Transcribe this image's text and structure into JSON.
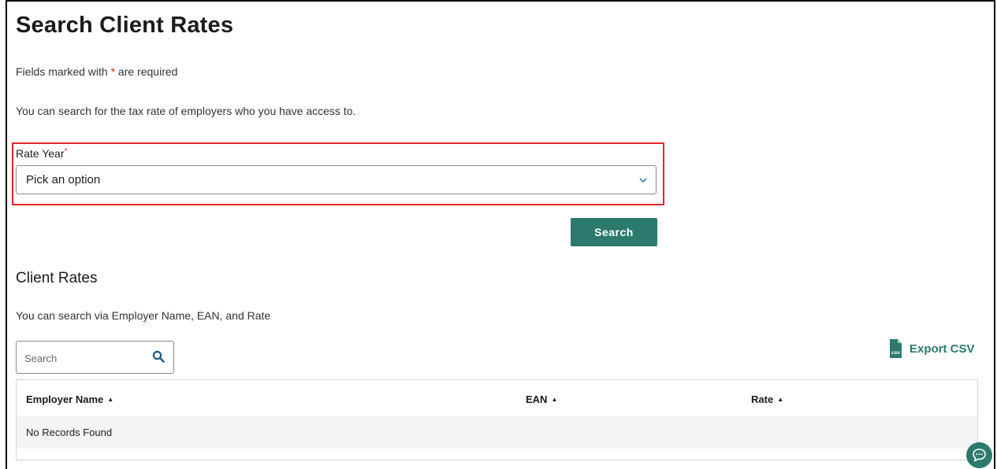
{
  "page": {
    "title": "Search Client Rates",
    "required_note_prefix": "Fields marked with ",
    "required_star": "*",
    "required_note_suffix": " are required",
    "intro": "You can search for the tax rate of employers who you have access to."
  },
  "rate_year": {
    "label": "Rate Year",
    "required_star": "*",
    "selected": "Pick an option"
  },
  "search_button": {
    "label": "Search"
  },
  "client_rates": {
    "title": "Client Rates",
    "intro": "You can search via Employer Name, EAN, and Rate",
    "search_placeholder": "Search",
    "export_label": "Export CSV",
    "export_icon_text": "csv",
    "columns": [
      {
        "label": "Employer Name",
        "sort": "▲"
      },
      {
        "label": "EAN",
        "sort": "▲"
      },
      {
        "label": "Rate",
        "sort": "▲"
      }
    ],
    "empty_message": "No Records Found"
  },
  "colors": {
    "accent": "#2c7a6e",
    "highlight_border": "#e3262b",
    "required": "#d0271d"
  },
  "icons": {
    "dropdown": "chevron-down-icon",
    "search": "search-icon",
    "export": "csv-file-icon",
    "chat": "chat-icon"
  }
}
